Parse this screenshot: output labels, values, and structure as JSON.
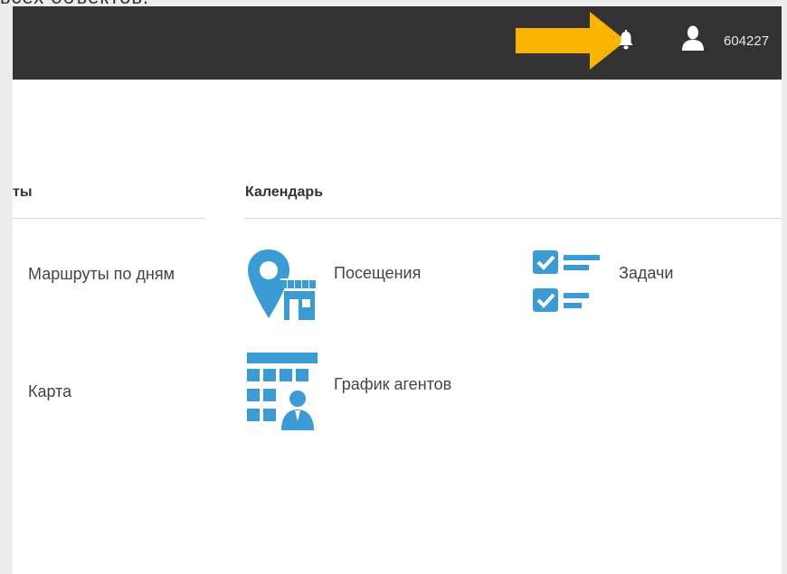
{
  "caption_fragment": "ьсех объектов.",
  "topbar": {
    "user_id": "604227"
  },
  "sections": {
    "routes": {
      "title": "ты",
      "links": [
        "Маршруты по дням",
        "Карта"
      ]
    },
    "calendar": {
      "title": "Календарь",
      "tiles": {
        "visits": "Посещения",
        "tasks": "Задачи",
        "agent_schedule": "График агентов"
      }
    }
  },
  "icons": {
    "notifications": "bell-icon",
    "user": "user-icon",
    "annotation": "arrow-right-icon",
    "visits": "map-pin-store-icon",
    "tasks": "checklist-icon",
    "agent_schedule": "schedule-person-icon"
  },
  "colors": {
    "topbar": "#333333",
    "accent_icon": "#3a9bd5",
    "annotation_arrow": "#f7b500",
    "background": "#ffffff"
  }
}
